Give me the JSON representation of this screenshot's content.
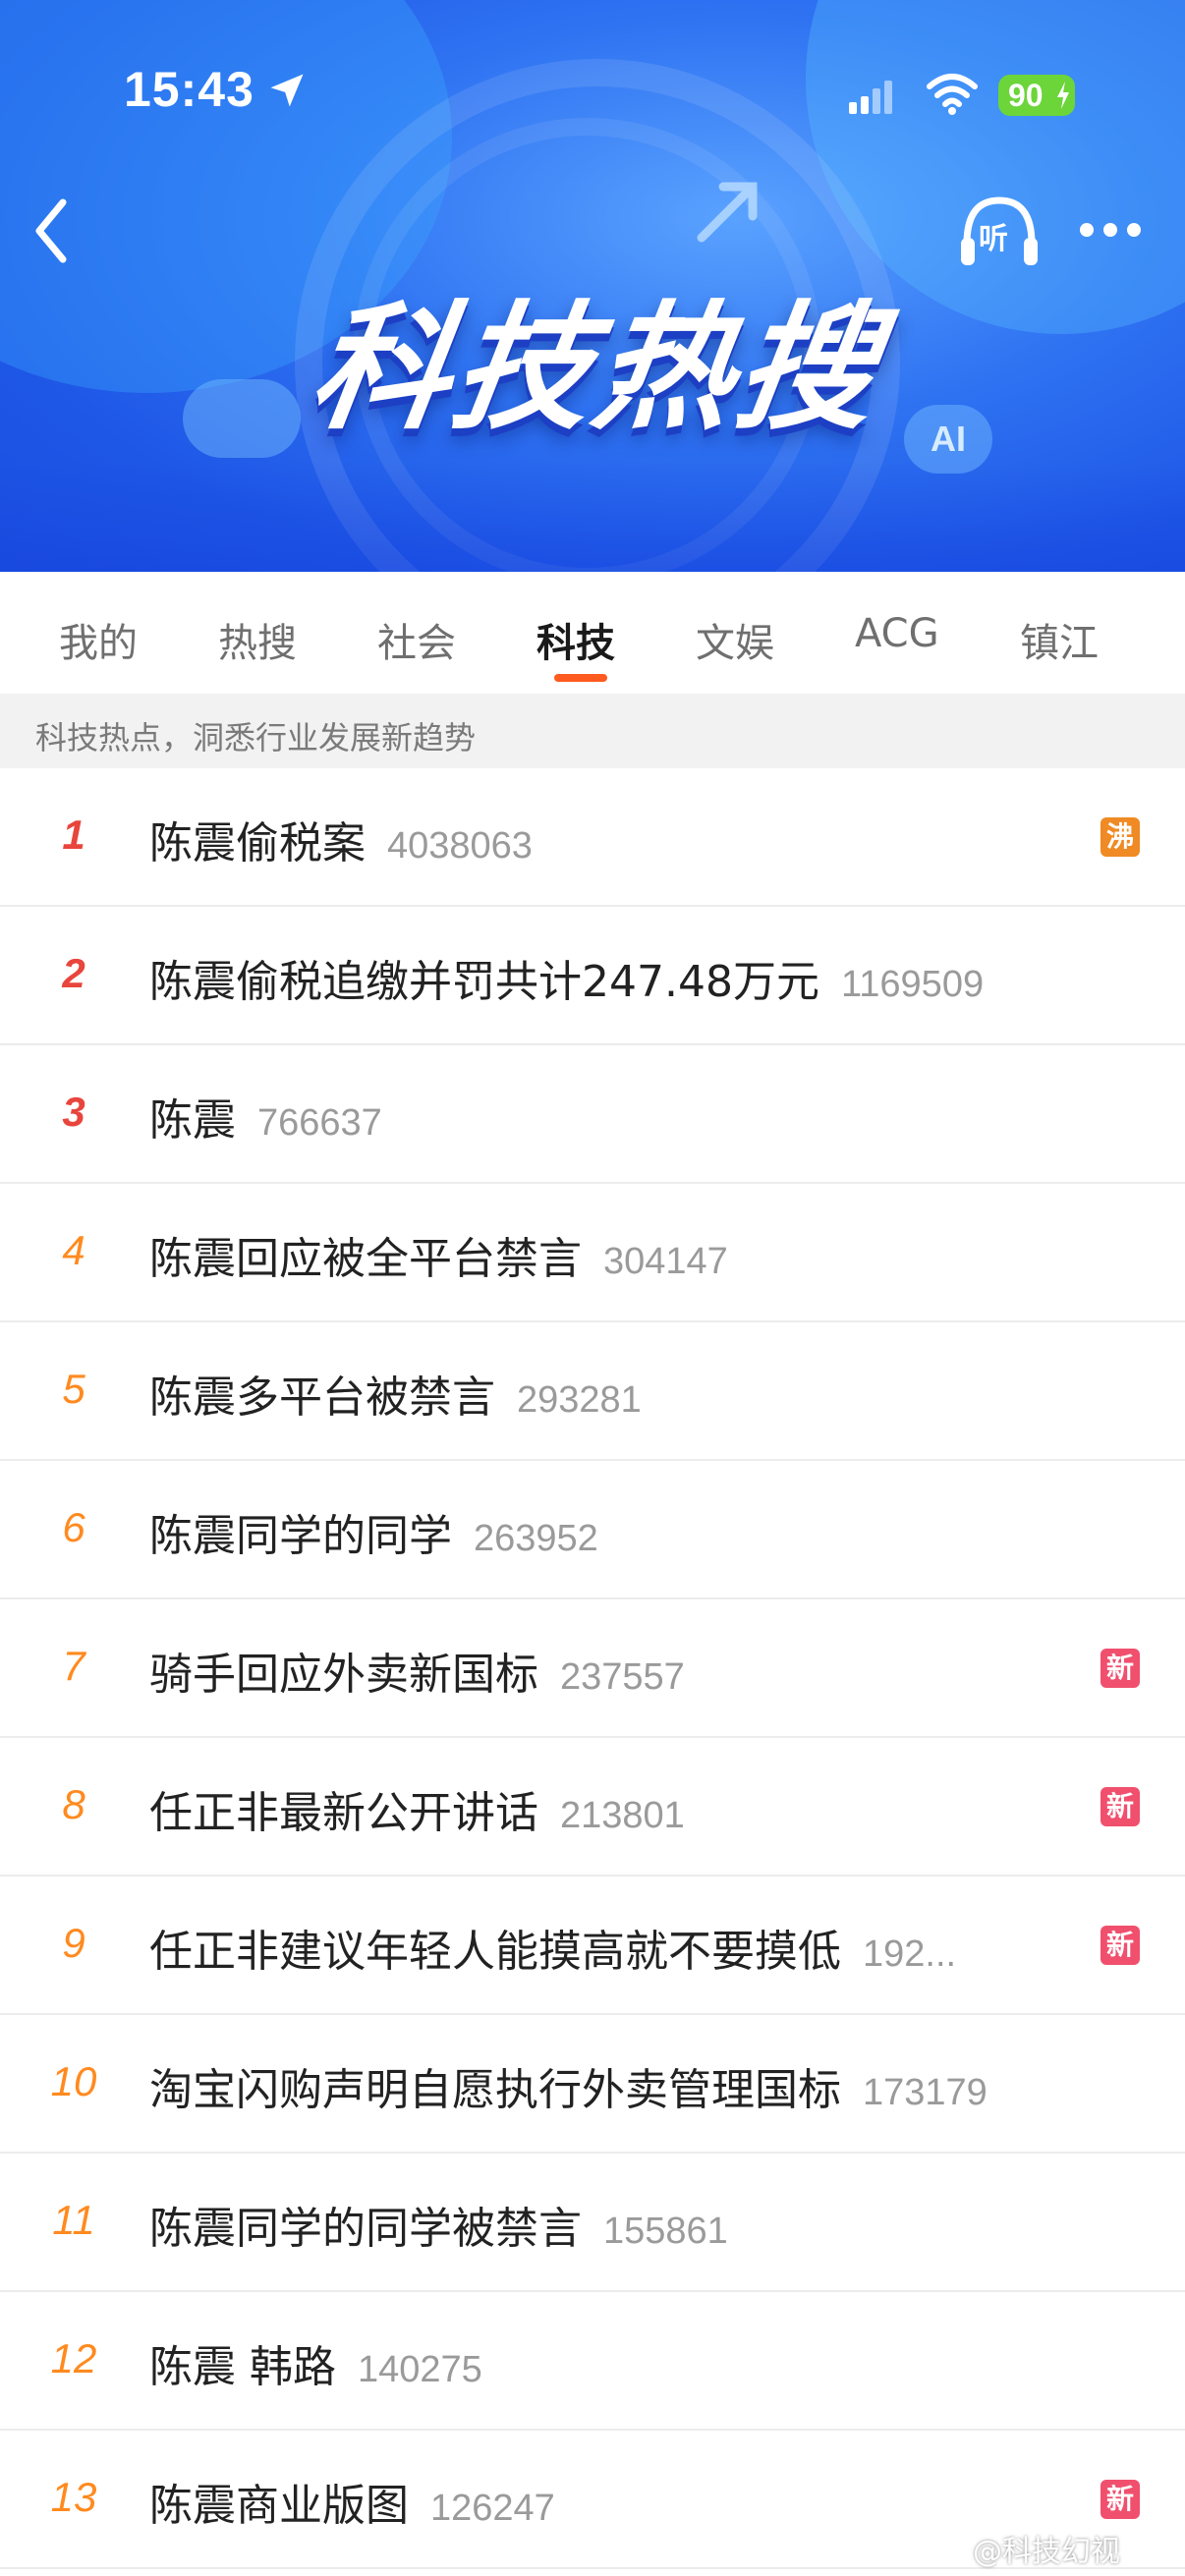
{
  "status_bar": {
    "time": "15:43",
    "battery": "90"
  },
  "banner": {
    "title": "科技热搜",
    "listen_label": "听",
    "ai_label": "AI"
  },
  "tabs": [
    {
      "label": "我的",
      "active": false
    },
    {
      "label": "热搜",
      "active": false
    },
    {
      "label": "社会",
      "active": false
    },
    {
      "label": "科技",
      "active": true
    },
    {
      "label": "文娱",
      "active": false
    },
    {
      "label": "ACG",
      "active": false
    },
    {
      "label": "镇江",
      "active": false
    }
  ],
  "subtitle": "科技热点，洞悉行业发展新趋势",
  "items": [
    {
      "rank": "1",
      "title": "陈震偷税案",
      "count": "4038063",
      "badge": "沸"
    },
    {
      "rank": "2",
      "title": "陈震偷税追缴并罚共计247.48万元",
      "count": "1169509",
      "badge": ""
    },
    {
      "rank": "3",
      "title": "陈震",
      "count": "766637",
      "badge": ""
    },
    {
      "rank": "4",
      "title": "陈震回应被全平台禁言",
      "count": "304147",
      "badge": ""
    },
    {
      "rank": "5",
      "title": "陈震多平台被禁言",
      "count": "293281",
      "badge": ""
    },
    {
      "rank": "6",
      "title": "陈震同学的同学",
      "count": "263952",
      "badge": ""
    },
    {
      "rank": "7",
      "title": "骑手回应外卖新国标",
      "count": "237557",
      "badge": "新"
    },
    {
      "rank": "8",
      "title": "任正非最新公开讲话",
      "count": "213801",
      "badge": "新"
    },
    {
      "rank": "9",
      "title": "任正非建议年轻人能摸高就不要摸低",
      "count": "192...",
      "badge": "新"
    },
    {
      "rank": "10",
      "title": "淘宝闪购声明自愿执行外卖管理国标",
      "count": "173179",
      "badge": ""
    },
    {
      "rank": "11",
      "title": "陈震同学的同学被禁言",
      "count": "155861",
      "badge": ""
    },
    {
      "rank": "12",
      "title": "陈震 韩路",
      "count": "140275",
      "badge": ""
    },
    {
      "rank": "13",
      "title": "陈震商业版图",
      "count": "126247",
      "badge": "新"
    }
  ],
  "watermark": "@科技幻视",
  "colors": {
    "accent": "#ff5a1f",
    "rank_top": "#e8453c",
    "rank_normal": "#ff8a1f",
    "badge_hot": "#f08a24",
    "badge_new": "#f0506e",
    "banner_blue": "#2f73f2"
  }
}
